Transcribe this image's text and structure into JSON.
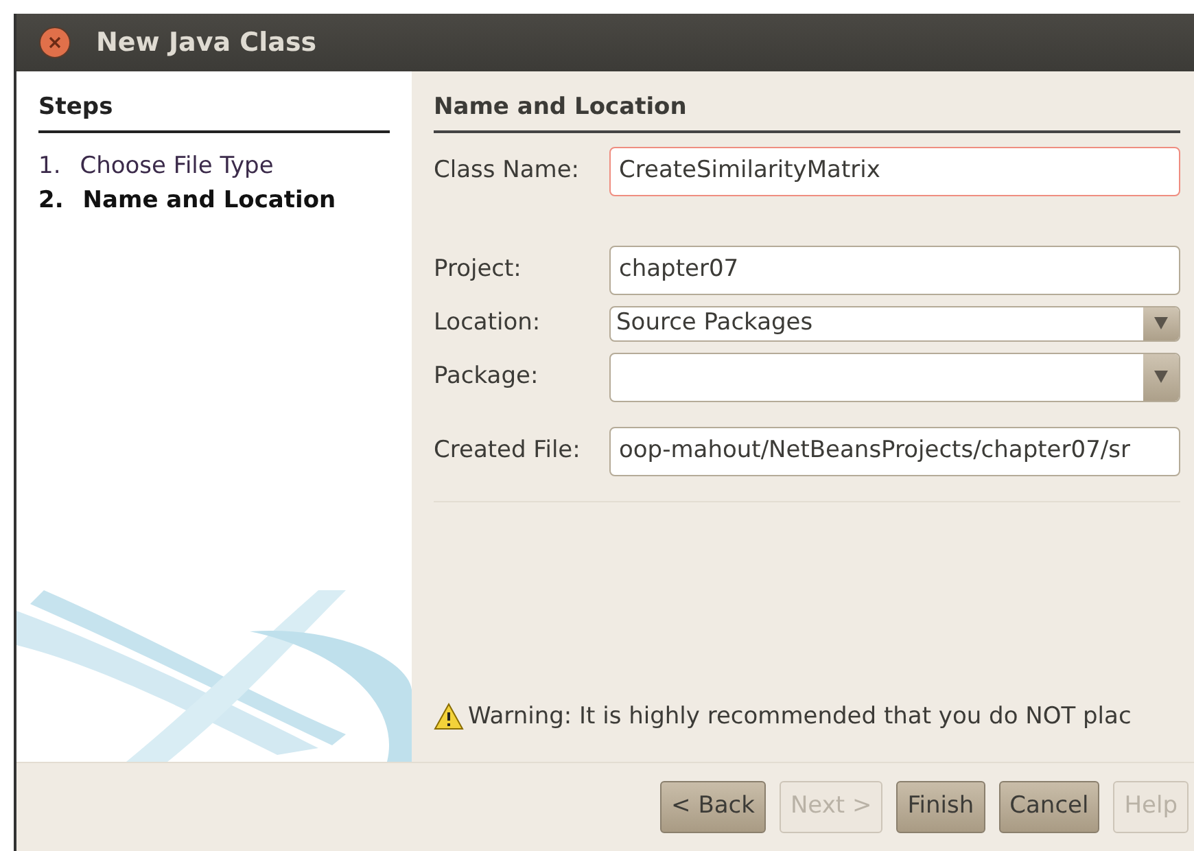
{
  "window": {
    "title": "New Java Class"
  },
  "steps": {
    "title": "Steps",
    "items": [
      {
        "number": "1.",
        "label": "Choose File Type",
        "selected": false
      },
      {
        "number": "2.",
        "label": "Name and Location",
        "selected": true
      }
    ]
  },
  "panel": {
    "title": "Name and Location"
  },
  "fields": [
    {
      "kind": "text",
      "label": "Class Name:",
      "value": "CreateSimilarityMatrix",
      "invalid": true
    },
    {
      "kind": "text",
      "label": "Project:",
      "value": "chapter07",
      "invalid": false
    },
    {
      "kind": "combo",
      "label": "Location:",
      "value": "Source Packages",
      "invalid": false
    },
    {
      "kind": "combo",
      "label": "Package:",
      "invalid": false
    },
    {
      "kind": "text",
      "label": "Created File:",
      "value": "oop-mahout/NetBeansProjects/chapter07/sr",
      "invalid": false
    }
  ],
  "warning": "Warning: It is highly recommended that you do NOT plac",
  "buttons": [
    {
      "label": "< Back",
      "disabled": false
    },
    {
      "label": "Next >",
      "disabled": true
    },
    {
      "label": "Finish",
      "disabled": false
    },
    {
      "label": "Cancel",
      "disabled": false
    },
    {
      "label": "Help",
      "disabled": true
    }
  ]
}
